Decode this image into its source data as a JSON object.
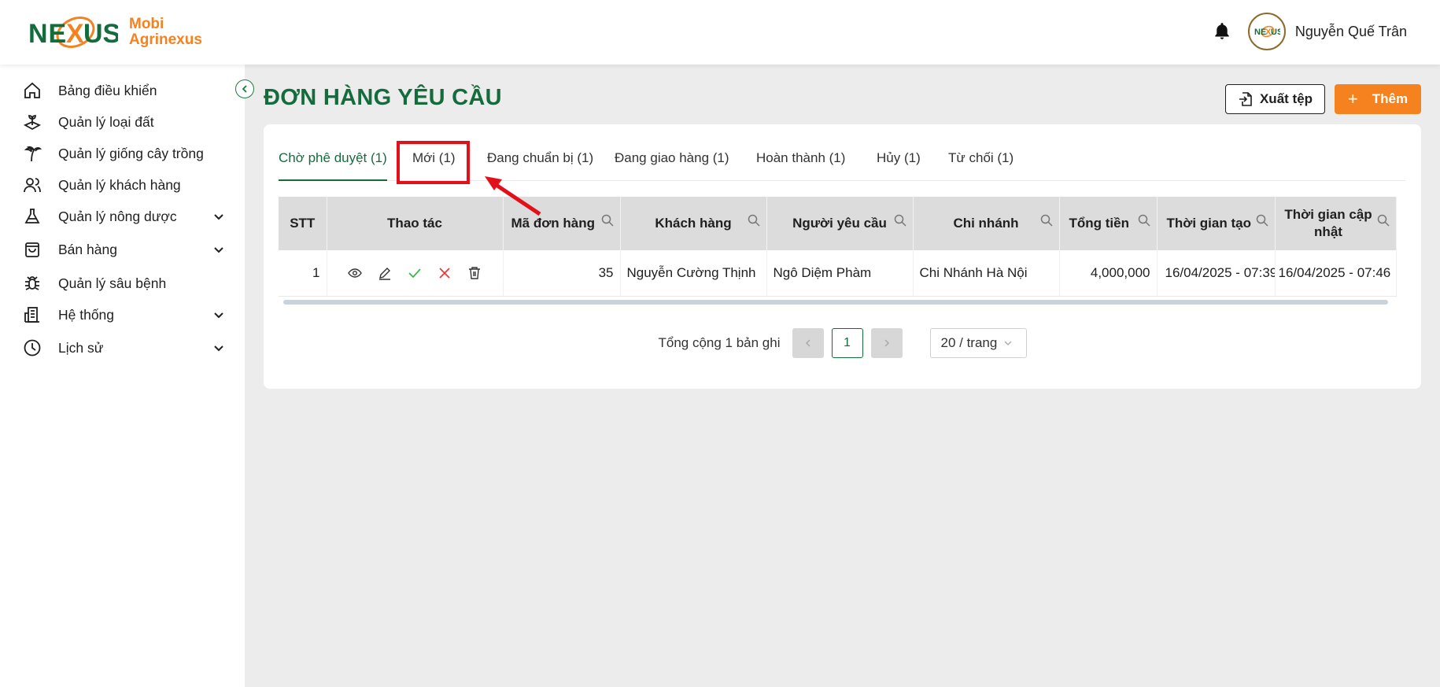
{
  "app": {
    "logo_text_line1": "Mobi",
    "logo_text_line2": "Agrinexus",
    "logo_mark": "NEXUS",
    "brand_green": "#146c3c",
    "brand_orange": "#f5821f"
  },
  "header": {
    "username": "Nguyễn Quế Trân",
    "bell_icon": "bell-icon"
  },
  "sidebar": {
    "items": [
      {
        "label": "Bảng điều khiển",
        "icon": "home-icon",
        "expandable": false
      },
      {
        "label": "Quản lý loại đất",
        "icon": "soil-icon",
        "expandable": false
      },
      {
        "label": "Quản lý giống cây trồng",
        "icon": "plant-icon",
        "expandable": false
      },
      {
        "label": "Quản lý khách hàng",
        "icon": "users-icon",
        "expandable": false
      },
      {
        "label": "Quản lý nông dược",
        "icon": "flask-icon",
        "expandable": true
      },
      {
        "label": "Bán hàng",
        "icon": "shopping-bag-icon",
        "expandable": true
      },
      {
        "label": "Quản lý sâu bệnh",
        "icon": "bug-icon",
        "expandable": false
      },
      {
        "label": "Hệ thống",
        "icon": "building-icon",
        "expandable": true
      },
      {
        "label": "Lịch sử",
        "icon": "clock-icon",
        "expandable": true
      }
    ]
  },
  "page": {
    "title": "ĐƠN HÀNG YÊU CẦU",
    "export_label": "Xuất tệp",
    "add_label": "Thêm"
  },
  "tabs": [
    {
      "label": "Chờ phê duyệt (1)",
      "active": true
    },
    {
      "label": "Mới (1)",
      "active": false
    },
    {
      "label": "Đang chuẩn bị (1)",
      "active": false
    },
    {
      "label": "Đang giao hàng (1)",
      "active": false
    },
    {
      "label": "Hoàn thành (1)",
      "active": false
    },
    {
      "label": "Hủy (1)",
      "active": false
    },
    {
      "label": "Từ chối (1)",
      "active": false
    }
  ],
  "table": {
    "columns": [
      "STT",
      "Thao tác",
      "Mã đơn hàng",
      "Khách hàng",
      "Người yêu cầu",
      "Chi nhánh",
      "Tổng tiền",
      "Thời gian tạo",
      "Thời gian cập nhật"
    ],
    "rows": [
      {
        "stt": "1",
        "ma_don_hang": "35",
        "khach_hang": "Nguyễn Cường Thịnh",
        "nguoi_yeu_cau": "Ngô Diệm Phàm",
        "chi_nhanh": "Chi Nhánh Hà Nội",
        "tong_tien": "4,000,000",
        "thoi_gian_tao": "16/04/2025 - 07:39",
        "thoi_gian_cap_nhat": "16/04/2025 - 07:46"
      }
    ]
  },
  "pagination": {
    "total_label": "Tổng cộng 1 bản ghi",
    "current_page": "1",
    "page_size": "20 / trang"
  }
}
